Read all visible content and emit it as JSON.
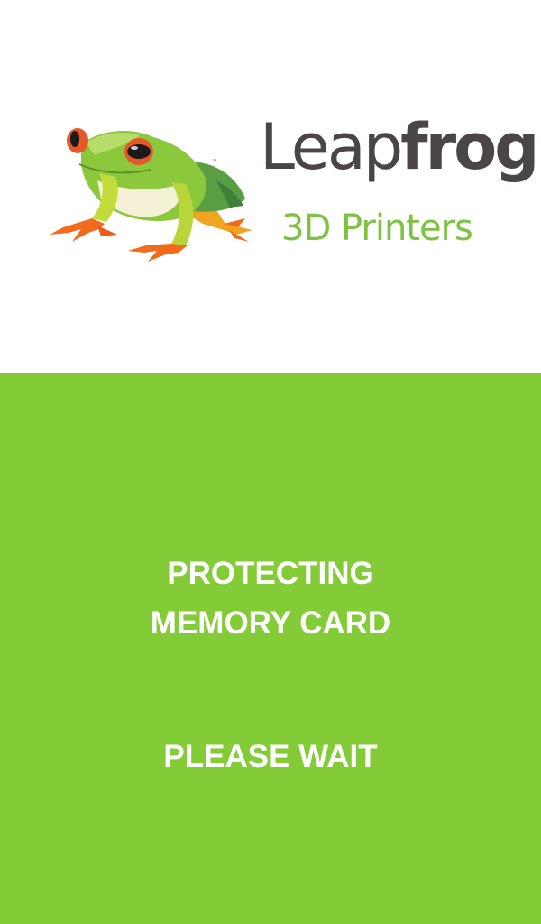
{
  "logo": {
    "brand_light": "Leap",
    "brand_bold": "frog",
    "trademark": "™",
    "tagline": "3D Printers",
    "mascot_icon": "tree-frog-icon"
  },
  "status": {
    "line1": "PROTECTING",
    "line2": "MEMORY CARD",
    "line3": "PLEASE WAIT"
  },
  "colors": {
    "panel_background": "#84cc37",
    "brand_text": "#4a4646",
    "tagline_text": "#7dc242",
    "message_text": "#ffffff"
  }
}
